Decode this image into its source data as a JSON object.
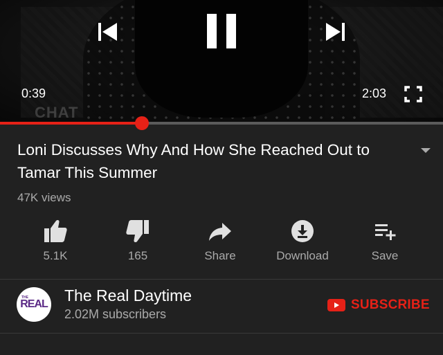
{
  "player": {
    "current_time": "0:39",
    "total_time": "2:03",
    "progress": 0.32,
    "watermark": "CHAT",
    "accent_color": "#e62117"
  },
  "video": {
    "title": "Loni Discusses Why And How She Reached Out to Tamar This Summer",
    "views": "47K views"
  },
  "actions": [
    {
      "icon": "thumbs-up-icon",
      "label": "5.1K"
    },
    {
      "icon": "thumbs-down-icon",
      "label": "165"
    },
    {
      "icon": "share-icon",
      "label": "Share"
    },
    {
      "icon": "download-icon",
      "label": "Download"
    },
    {
      "icon": "save-to-playlist-icon",
      "label": "Save"
    }
  ],
  "channel": {
    "name": "The Real Daytime",
    "subscribers": "2.02M subscribers",
    "avatar_text": "REAL",
    "avatar_small_text": "THE"
  },
  "subscribe": {
    "label": "SUBSCRIBE",
    "icon": "youtube-play-icon"
  }
}
